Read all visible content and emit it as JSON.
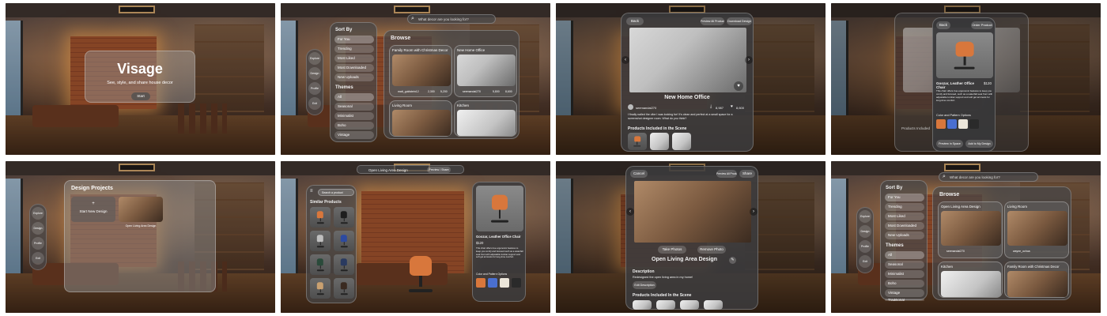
{
  "colors": {
    "accent_orange": "#d8773c",
    "swatch_blue": "#4a6fd0",
    "swatch_cream": "#ece6da",
    "swatch_black": "#2a2a2a"
  },
  "panel1": {
    "app_title": "Visage",
    "tagline": "See, style, and share house decor",
    "start_button": "Start"
  },
  "ornament_nav": [
    "Explore",
    "Design",
    "Profile",
    "Exit"
  ],
  "panel2": {
    "search_placeholder": "What decor are you looking for?",
    "sort_heading": "Sort By",
    "sort_options": [
      "For You",
      "Trending",
      "Most Liked",
      "Most Downloaded",
      "New Uploads"
    ],
    "themes_heading": "Themes",
    "themes": [
      "All",
      "Seasonal",
      "Minimalist",
      "Boho",
      "Vintage",
      "Traditional"
    ],
    "browse_heading": "Browse",
    "cards": [
      {
        "title": "Family Room with Christmas Decor",
        "user": "matt_goldstein12",
        "downloads": "2,300",
        "likes": "5,200"
      },
      {
        "title": "New Home Office",
        "user": "seemandai270",
        "downloads": "5,800",
        "likes": "8,600"
      },
      {
        "title": "Living Room",
        "user": "",
        "downloads": "",
        "likes": ""
      },
      {
        "title": "Kitchen",
        "user": "",
        "downloads": "",
        "likes": ""
      }
    ]
  },
  "panel3": {
    "back": "Back",
    "preview_all": "Preview All Products",
    "download": "Download Design",
    "title": "New Home Office",
    "user": "seemandai270",
    "downloads": "8,987",
    "likes": "8,600",
    "description": "I finally nailed the vibe I was looking for! It's clean and perfect at a small space for a screenshot designer room. What do you think?",
    "products_heading": "Products Included in the Scene"
  },
  "panel4": {
    "back": "Back",
    "order": "Order Product",
    "product_name": "Goozar, Leather Office Chair",
    "price": "$120",
    "description": "This chair offers true ergonomic features to keep you comfy and focused, such as a waterfall seat front with adjustable lumbar support and soft gel armrests for long-time comfort.",
    "options_heading": "Color and Pattern Options",
    "preview_in_space": "Preview in Space",
    "add_to_design": "Add to My Design",
    "bg_products_heading": "Products Included"
  },
  "panel5": {
    "heading": "Design Projects",
    "new_design": "Start New Design",
    "project_name": "Open Living Area Design"
  },
  "panel6": {
    "title_bar": "Open Living Area Design",
    "preview_share": "Preview / Share",
    "search_placeholder": "Search a product",
    "similar_heading": "Similar Products",
    "product_name": "Goozar, Leather Office Chair",
    "price": "$120",
    "description": "This chair offers true ergonomic features to keep you comfy and focused such as a waterfall seat front with adjustable lumbar support and soft gel armrests for long-time comfort.",
    "options_heading": "Color and Pattern Options"
  },
  "panel7": {
    "cancel": "Cancel",
    "preview_all": "Preview All Products",
    "share": "Share",
    "take_photos": "Take Photos",
    "remove_photo": "Remove Photo",
    "title": "Open Living Area Design",
    "description_heading": "Description",
    "description": "Redesigned the open living area in my home!",
    "edit_description": "Edit Description",
    "products_heading": "Products Included In the Scene"
  },
  "panel8": {
    "search_placeholder": "What decor are you looking for?",
    "sort_heading": "Sort By",
    "sort_options": [
      "For You",
      "Trending",
      "Most Liked",
      "Most Downloaded",
      "New Uploads"
    ],
    "themes_heading": "Themes",
    "themes": [
      "All",
      "Seasonal",
      "Minimalist",
      "Boho",
      "Vintage",
      "Traditional"
    ],
    "browse_heading": "Browse",
    "cards": [
      {
        "title": "Open Living Area Design",
        "user": "seemandai270",
        "downloads": "",
        "likes": ""
      },
      {
        "title": "Living Room",
        "user": "wayne_ochoa",
        "downloads": "",
        "likes": ""
      },
      {
        "title": "Kitchen",
        "user": "",
        "downloads": "",
        "likes": ""
      },
      {
        "title": "Family Room with Christmas Decor",
        "user": "",
        "downloads": "",
        "likes": ""
      }
    ]
  }
}
